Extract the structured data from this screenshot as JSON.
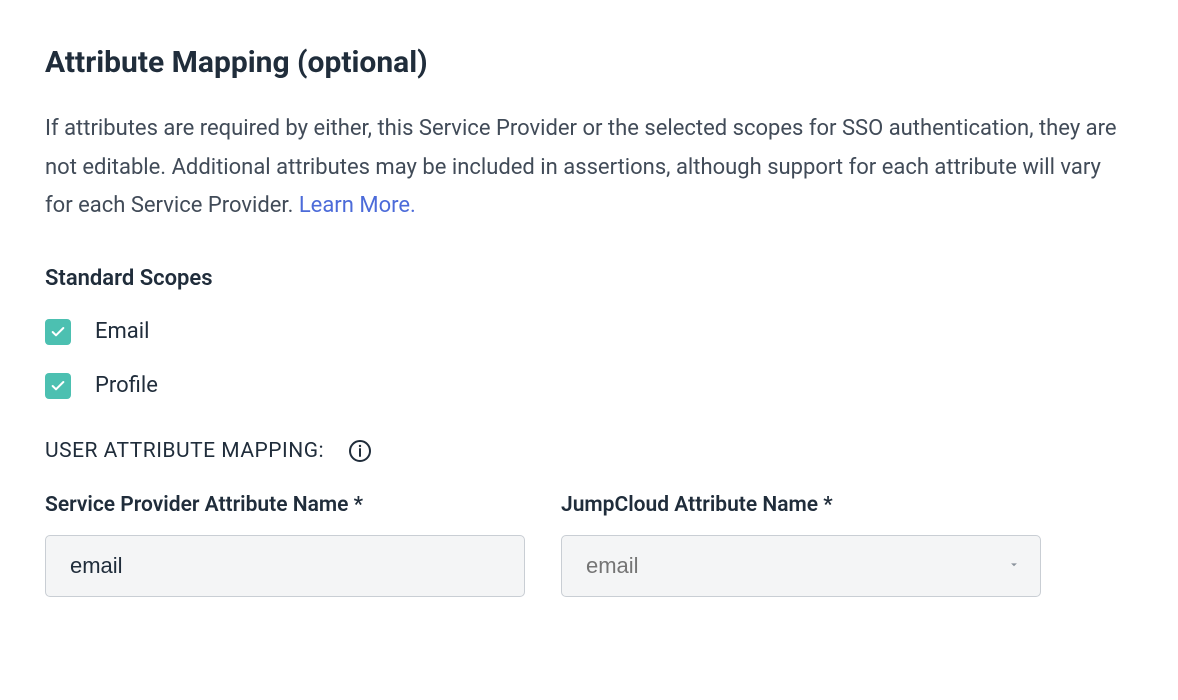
{
  "heading": "Attribute Mapping (optional)",
  "description": {
    "text": "If attributes are required by either, this Service Provider or the selected scopes for SSO authentication, they are not editable. Additional attributes may be included in assertions, although support for each attribute will vary for each Service Provider. ",
    "linkText": "Learn More."
  },
  "standardScopes": {
    "label": "Standard Scopes",
    "items": [
      {
        "label": "Email",
        "checked": true
      },
      {
        "label": "Profile",
        "checked": true
      }
    ]
  },
  "userAttributeMapping": {
    "title": "USER ATTRIBUTE MAPPING:",
    "columns": {
      "spAttributeName": {
        "label": "Service Provider Attribute Name *",
        "value": "email"
      },
      "jcAttributeName": {
        "label": "JumpCloud Attribute Name *",
        "placeholder": "email"
      }
    }
  }
}
